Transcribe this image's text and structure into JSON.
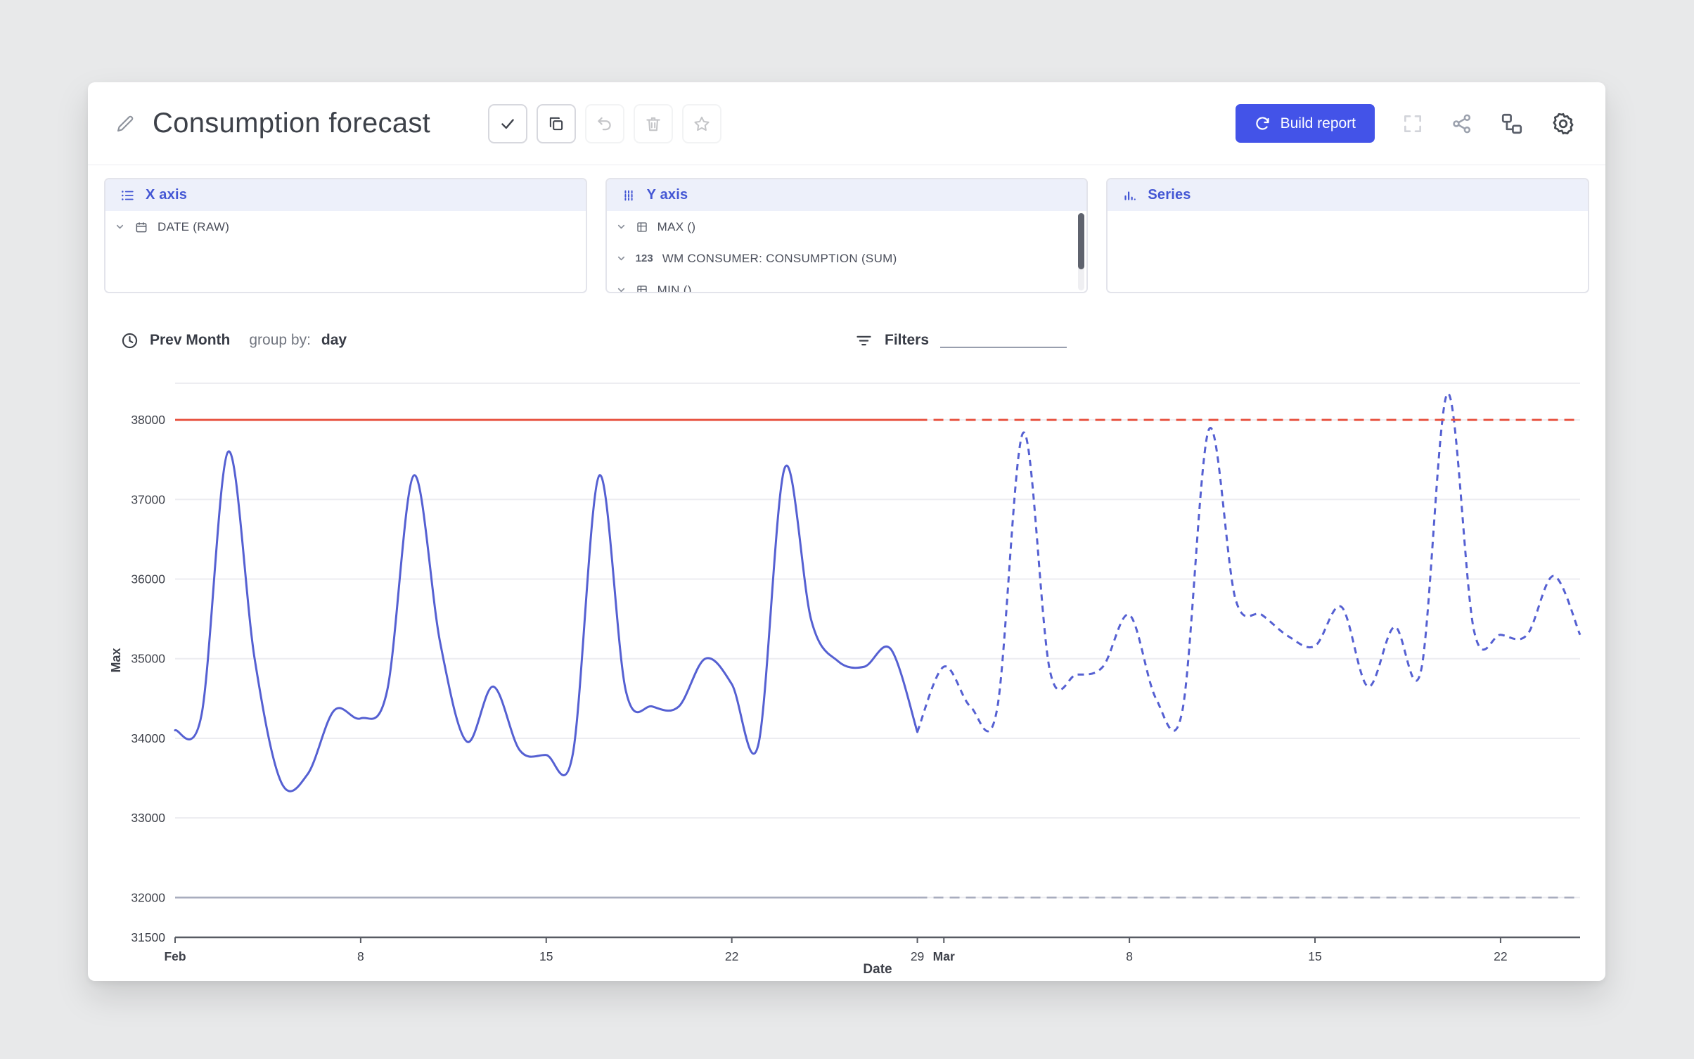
{
  "header": {
    "title": "Consumption forecast",
    "build_report_label": "Build report"
  },
  "panels": {
    "x_axis": {
      "label": "X axis",
      "items": [
        {
          "label": "DATE (RAW)"
        }
      ]
    },
    "y_axis": {
      "label": "Y axis",
      "items": [
        {
          "label": "MAX ()"
        },
        {
          "prefix": "123",
          "label": "WM CONSUMER: CONSUMPTION (SUM)"
        },
        {
          "label": "MIN ()"
        }
      ]
    },
    "series": {
      "label": "Series"
    }
  },
  "controls": {
    "period": "Prev Month",
    "group_by_label": "group by:",
    "group_by_value": "day",
    "filters_label": "Filters"
  },
  "chart_data": {
    "type": "line",
    "xlabel": "Date",
    "ylabel": "Max",
    "ylim": [
      31500,
      38460
    ],
    "yticks": [
      38000,
      37000,
      36000,
      35000,
      34000,
      33000,
      32000,
      31500
    ],
    "x_count": 54,
    "forecast_start_index": 28,
    "x_start": "Feb 1",
    "x_ticks": [
      {
        "i": 0,
        "label": "Feb",
        "bold": true
      },
      {
        "i": 7,
        "label": "8"
      },
      {
        "i": 14,
        "label": "15"
      },
      {
        "i": 21,
        "label": "22"
      },
      {
        "i": 28,
        "label": "29"
      },
      {
        "i": 29,
        "label": "Mar",
        "bold": true
      },
      {
        "i": 36,
        "label": "8"
      },
      {
        "i": 43,
        "label": "15"
      },
      {
        "i": 50,
        "label": "22"
      }
    ],
    "series": [
      {
        "name": "max-wm-consumer-consumption",
        "color": "#5560d2",
        "style": "solid-then-dashed",
        "values": [
          34100,
          34300,
          37600,
          35000,
          33450,
          33550,
          34350,
          34250,
          34600,
          37300,
          35200,
          33960,
          34650,
          33850,
          33790,
          33800,
          37300,
          34600,
          34400,
          34400,
          35000,
          34680,
          33920,
          37400,
          35480,
          34970,
          34900,
          35120,
          34080,
          34900,
          34400,
          34350,
          37840,
          34850,
          34800,
          34900,
          35550,
          34500,
          34350,
          37880,
          35750,
          35550,
          35280,
          35160,
          35650,
          34650,
          35400,
          34850,
          38330,
          35350,
          35300,
          35300,
          36040,
          35300
        ]
      },
      {
        "name": "upper-threshold",
        "color": "#e85442",
        "style": "solid-then-dashed",
        "constant": 38000
      },
      {
        "name": "lower-threshold",
        "color": "#a6abbd",
        "style": "solid-then-dashed",
        "constant": 32000
      }
    ],
    "grid": "horizontal-only",
    "legend": "none"
  }
}
